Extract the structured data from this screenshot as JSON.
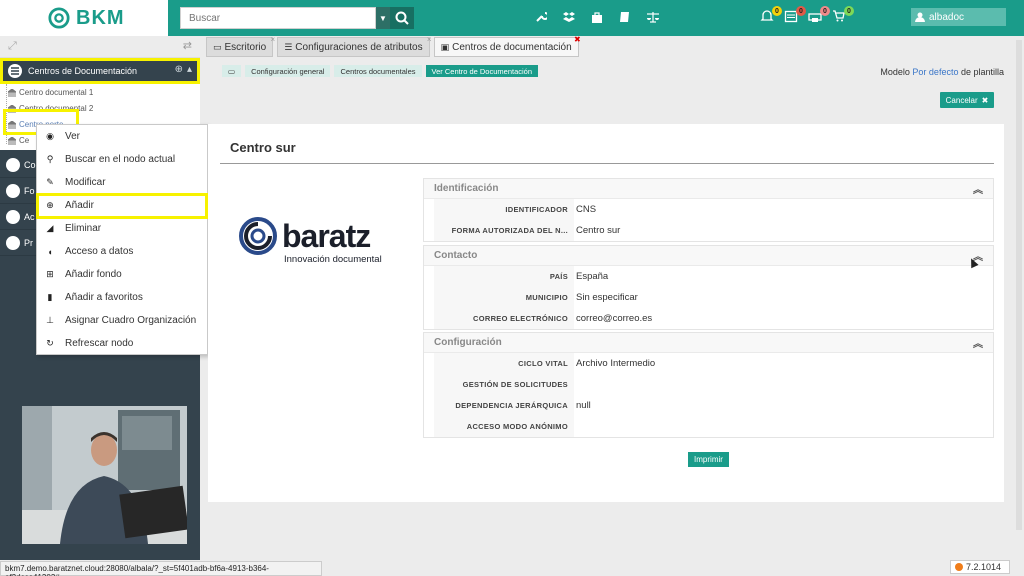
{
  "app": {
    "logo_text": "BKM"
  },
  "search": {
    "placeholder": "Buscar"
  },
  "toolbar_icons": [
    "wrench-icon",
    "dropbox-icon",
    "bag-icon",
    "book-icon",
    "scale-icon"
  ],
  "notifications": [
    {
      "icon": "bell-icon",
      "count": "0",
      "color": "#f5d20a"
    },
    {
      "icon": "calendar-icon",
      "count": "0",
      "color": "#e05a47"
    },
    {
      "icon": "printer-icon",
      "count": "0",
      "color": "#f08a8a"
    },
    {
      "icon": "cart-icon",
      "count": "0",
      "color": "#7ed957"
    }
  ],
  "user": {
    "name": "albadoc"
  },
  "sidebar": {
    "header": "Centros de Documentación",
    "tree": [
      {
        "label": "Centro documental 1"
      },
      {
        "label": "Centro documental 2"
      },
      {
        "label": "Centro norte"
      },
      {
        "label": "Ce"
      }
    ],
    "nav": [
      {
        "label": "Co"
      },
      {
        "label": "Fo"
      },
      {
        "label": "Ac"
      },
      {
        "label": "Pr"
      }
    ]
  },
  "context_menu": {
    "items": [
      {
        "label": "Ver",
        "icon": "eye-icon"
      },
      {
        "label": "Buscar en el nodo actual",
        "icon": "search-icon"
      },
      {
        "label": "Modificar",
        "icon": "pencil-icon"
      },
      {
        "label": "Añadir",
        "icon": "plus-circle-icon"
      },
      {
        "label": "Eliminar",
        "icon": "eraser-icon"
      },
      {
        "label": "Acceso a datos",
        "icon": "shield-icon"
      },
      {
        "label": "Añadir fondo",
        "icon": "plus-square-icon"
      },
      {
        "label": "Añadir a favoritos",
        "icon": "bookmark-icon"
      },
      {
        "label": "Asignar Cuadro Organización",
        "icon": "sitemap-icon"
      },
      {
        "label": "Refrescar nodo",
        "icon": "refresh-icon"
      }
    ]
  },
  "tabs": [
    {
      "label": "Escritorio"
    },
    {
      "label": "Configuraciones de atributos"
    },
    {
      "label": "Centros de documentación"
    }
  ],
  "breadcrumbs": [
    "Configuración general",
    "Centros documentales",
    "Ver Centro de Documentación"
  ],
  "modelo": {
    "prefix": "Modelo",
    "link": "Por defecto",
    "suffix": "de plantilla"
  },
  "buttons": {
    "cancel": "Cancelar",
    "print": "Imprimir"
  },
  "record": {
    "title": "Centro sur",
    "brand_name": "baratz",
    "brand_sub": "Innovación documental"
  },
  "sections": [
    {
      "title": "Identificación",
      "rows": [
        {
          "key": "IDENTIFICADOR",
          "value": "CNS"
        },
        {
          "key": "FORMA AUTORIZADA DEL N...",
          "value": "Centro sur"
        }
      ]
    },
    {
      "title": "Contacto",
      "rows": [
        {
          "key": "PAÍS",
          "value": "España"
        },
        {
          "key": "MUNICIPIO",
          "value": "Sin especificar"
        },
        {
          "key": "CORREO ELECTRÓNICO",
          "value": "correo@correo.es"
        }
      ]
    },
    {
      "title": "Configuración",
      "rows": [
        {
          "key": "CICLO VITAL",
          "value": "Archivo Intermedio"
        },
        {
          "key": "GESTIÓN DE SOLICITUDES",
          "value": ""
        },
        {
          "key": "DEPENDENCIA JERÁRQUICA",
          "value": "null"
        },
        {
          "key": "ACCESO MODO ANÓNIMO",
          "value": ""
        }
      ]
    }
  ],
  "status": {
    "url": "bkm7.demo.baratznet.cloud:28080/albala/?_st=5f401adb-bf6a-4913-b364-af2dcce41303#",
    "version": "7.2.1014"
  }
}
